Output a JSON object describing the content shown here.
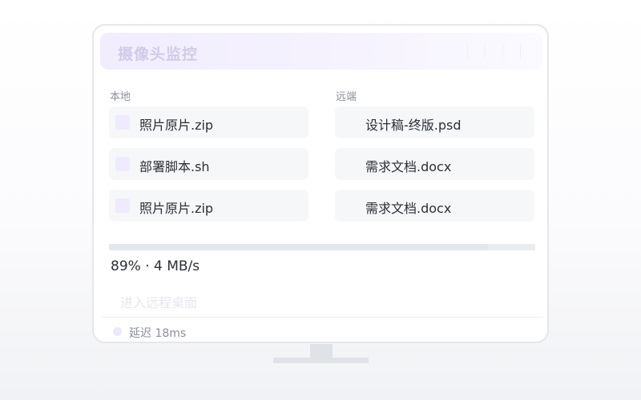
{
  "app": {
    "title": "摄像头监控"
  },
  "local": {
    "label": "本地",
    "files": [
      {
        "name": "照片原片.zip"
      },
      {
        "name": "部署脚本.sh"
      },
      {
        "name": "照片原片.zip"
      }
    ]
  },
  "remote": {
    "label": "远端",
    "files": [
      {
        "name": "设计稿-终版.psd"
      },
      {
        "name": "需求文档.docx"
      },
      {
        "name": "需求文档.docx"
      }
    ]
  },
  "transfer": {
    "percent": 89,
    "stats": "89% · 4 MB/s"
  },
  "actions": {
    "enter_remote": "进入远程桌面"
  },
  "status": {
    "latency": "延迟 18ms"
  },
  "colors": {
    "accent_light": "#efeafd",
    "title_bg": "#f1edfd",
    "card_bg": "#f6f7f9",
    "progress_track": "#e9ecf1"
  }
}
